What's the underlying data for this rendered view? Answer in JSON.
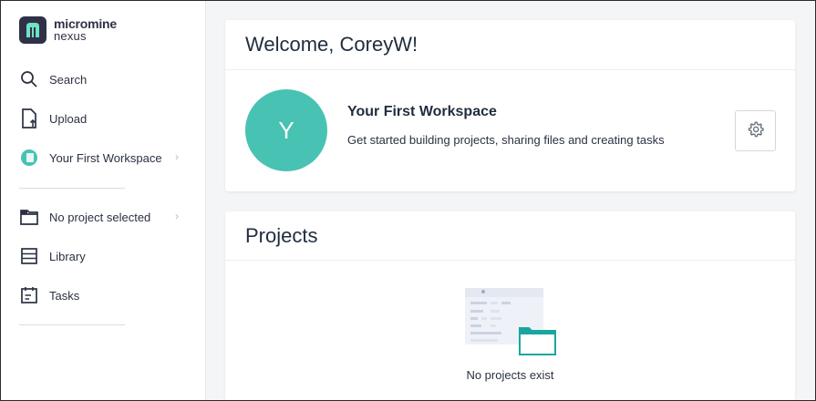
{
  "logo": {
    "line1": "micromine",
    "line2": "nexus"
  },
  "sidebar": {
    "items": [
      {
        "label": "Search",
        "icon": "search-icon"
      },
      {
        "label": "Upload",
        "icon": "upload-file-icon"
      },
      {
        "label": "Your First Workspace",
        "icon": "workspace-avatar-icon"
      },
      {
        "label": "No project selected",
        "icon": "folder-icon"
      },
      {
        "label": "Library",
        "icon": "library-icon"
      },
      {
        "label": "Tasks",
        "icon": "tasks-icon"
      }
    ]
  },
  "welcome": {
    "title": "Welcome, CoreyW!",
    "avatar_letter": "Y",
    "workspace_name": "Your First Workspace",
    "workspace_desc": "Get started building projects, sharing files and creating tasks"
  },
  "projects": {
    "title": "Projects",
    "empty_text": "No projects exist"
  },
  "colors": {
    "accent": "#48c2b3",
    "brand_dark": "#2f3146",
    "folder": "#1aa6a0"
  }
}
